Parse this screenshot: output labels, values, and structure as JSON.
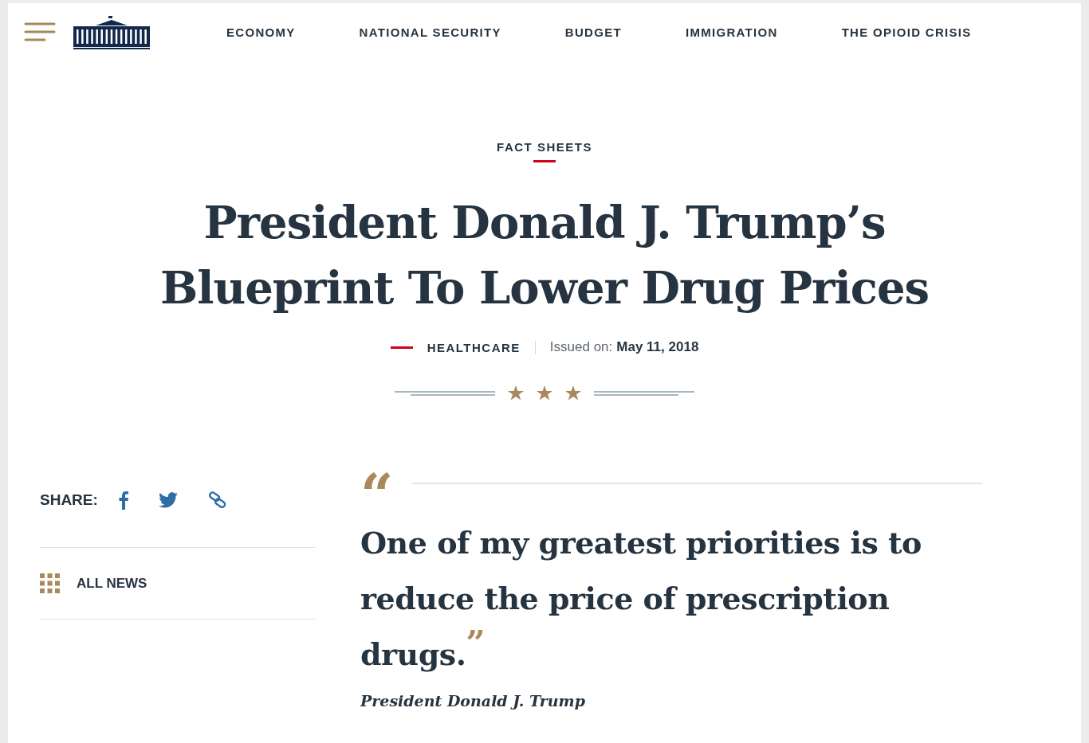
{
  "nav": {
    "items": [
      "ECONOMY",
      "NATIONAL SECURITY",
      "BUDGET",
      "IMMIGRATION",
      "THE OPIOID CRISIS"
    ]
  },
  "article": {
    "category": "FACT SHEETS",
    "title_lines": [
      "President Donald J. Trump’s",
      "Blueprint To Lower Drug Prices"
    ],
    "topic": "HEALTHCARE",
    "issued_label": "Issued on:",
    "issued_date": "May 11, 2018"
  },
  "share": {
    "label": "SHARE:",
    "all_news": "ALL NEWS"
  },
  "quote": {
    "open_mark": "“",
    "text": "One of my greatest priorities is to reduce the price of prescription drugs.",
    "close_mark": "”",
    "attribution": "President Donald J. Trump"
  }
}
